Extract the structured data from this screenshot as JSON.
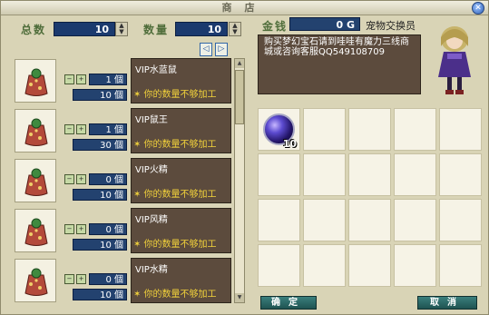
{
  "window": {
    "title": "商店",
    "close_glyph": "✕"
  },
  "left_header": {
    "total_label": "总数",
    "total_value": "10",
    "qty_label": "数量",
    "qty_value": "10",
    "spin_up": "▲",
    "spin_down": "▼",
    "prev_page": "◁",
    "next_page": "▷"
  },
  "items": [
    {
      "name": "VIP水蓝鼠",
      "qty": "1",
      "price": "10",
      "warn": "✶ 你的数量不够加工"
    },
    {
      "name": "VIP鼠王",
      "qty": "1",
      "price": "30",
      "warn": "✶ 你的数量不够加工"
    },
    {
      "name": "VIP火精",
      "qty": "0",
      "price": "10",
      "warn": "✶ 你的数量不够加工"
    },
    {
      "name": "VIP风精",
      "qty": "0",
      "price": "10",
      "warn": "✶ 你的数量不够加工"
    },
    {
      "name": "VIP水精",
      "qty": "0",
      "price": "10",
      "warn": "✶ 你的数量不够加工"
    }
  ],
  "unit_glyph": "個",
  "money": {
    "label": "金钱",
    "value": "0"
  },
  "npc": {
    "name": "宠物交换员"
  },
  "dialog": {
    "text": "购买梦幻宝石请到哇哇有魔力三线商城或咨询客服QQ549108709"
  },
  "inventory": {
    "first_item_count": "10"
  },
  "buttons": {
    "confirm": "确定",
    "cancel": "取消"
  },
  "colors": {
    "panel_dark": "#5c4b3d",
    "value_box": "#23426f",
    "warn_text": "#f2d23b",
    "button_teal": "#1f5351"
  }
}
